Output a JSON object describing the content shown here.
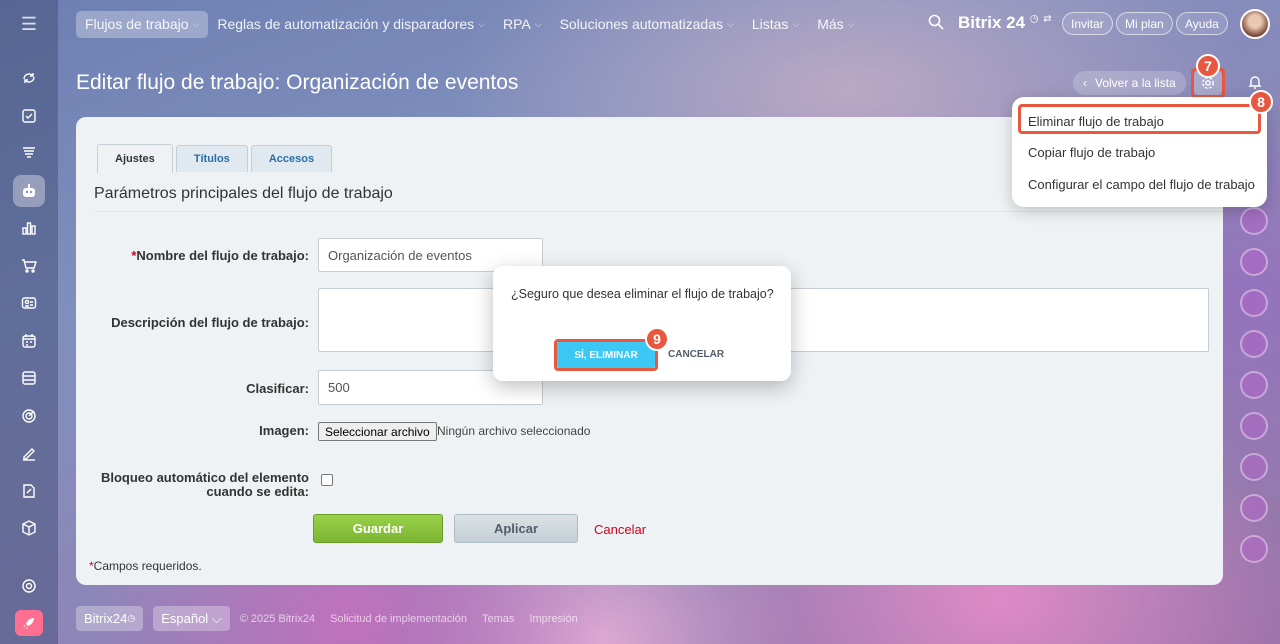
{
  "topbar": {
    "nav": [
      {
        "label": "Flujos de trabajo",
        "chevron": "⌵"
      },
      {
        "label": "Reglas de automatización y disparadores",
        "chevron": "⌵"
      },
      {
        "label": "RPA",
        "chevron": "⌵"
      },
      {
        "label": "Soluciones automatizadas",
        "chevron": "⌵"
      },
      {
        "label": "Listas",
        "chevron": "⌵"
      },
      {
        "label": "Más",
        "chevron": "⌵"
      }
    ],
    "logo": "Bitrix 24",
    "invite": "Invitar",
    "my_plan": "Mi plan",
    "help": "Ayuda"
  },
  "page": {
    "title": "Editar flujo de trabajo: Organización de eventos",
    "back_label": "Volver a la lista"
  },
  "badges": {
    "gear": "7",
    "menu_item": "8",
    "confirm": "9"
  },
  "tabs": [
    "Ajustes",
    "Títulos",
    "Accesos"
  ],
  "form": {
    "section_title": "Parámetros principales del flujo de trabajo",
    "required_mark": "*",
    "name_label": "Nombre del flujo de trabajo:",
    "name_value": "Organización de eventos",
    "description_label": "Descripción del flujo de trabajo:",
    "description_value": "",
    "sort_label": "Clasificar:",
    "sort_value": "500",
    "image_label": "Imagen:",
    "file_button": "Seleccionar archivo",
    "file_status": "Ningún archivo seleccionado",
    "autolock_label_line1": "Bloqueo automático del elemento",
    "autolock_label_line2": "cuando se edita:",
    "autolock_checked": false,
    "save": "Guardar",
    "apply": "Aplicar",
    "cancel": "Cancelar",
    "required_note": "Campos requeridos."
  },
  "dropdown": {
    "items": [
      "Eliminar flujo de trabajo",
      "Copiar flujo de trabajo",
      "Configurar el campo del flujo de trabajo"
    ]
  },
  "dialog": {
    "question": "¿Seguro que desea eliminar el flujo de trabajo?",
    "confirm": "SÍ, ELIMINAR",
    "cancel": "CANCELAR"
  },
  "footer": {
    "brand": "Bitrix24",
    "language": "Español",
    "copyright": "© 2025 Bitrix24",
    "links": [
      "Solicitud de implementación",
      "Temas",
      "Impresión"
    ]
  },
  "sidebar_icons": [
    "menu-icon",
    "feed-icon",
    "tasks-icon",
    "crm-icon",
    "automation-icon",
    "analytics-icon",
    "shop-icon",
    "contacts-icon",
    "calendar-icon",
    "inventory-icon",
    "goals-icon",
    "sign-icon",
    "documents-icon",
    "box-icon",
    "settings-icon",
    "rocket-icon"
  ],
  "colors": {
    "accent": "#e8573f",
    "save": "#7cb632",
    "confirm": "#3bc8f5",
    "link": "#2d6ea6",
    "danger": "#d2001d"
  }
}
